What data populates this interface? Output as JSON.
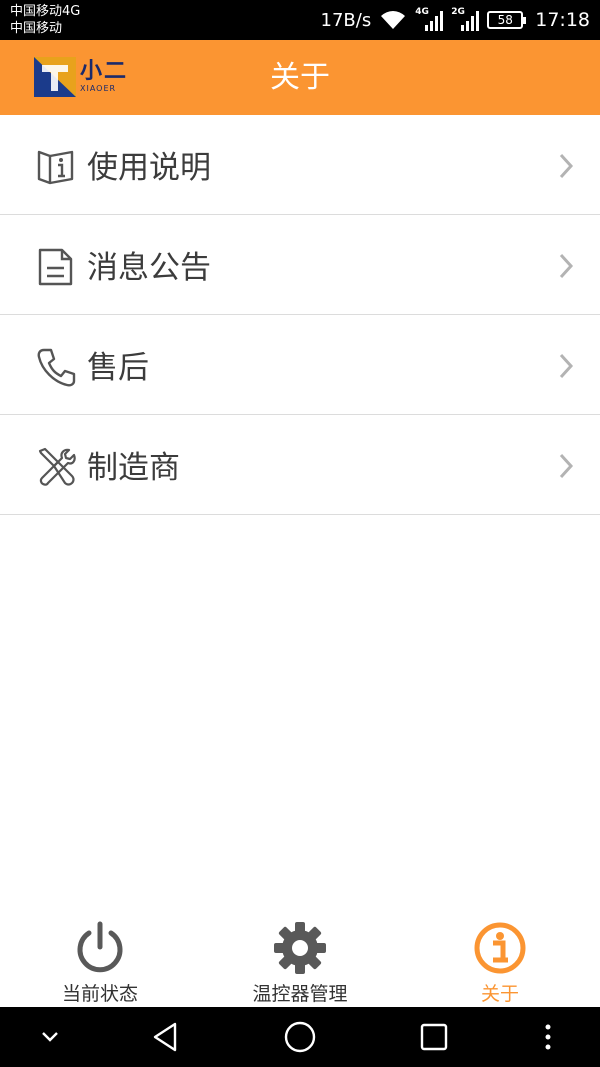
{
  "status_bar": {
    "carrier_1": "中国移动4G",
    "carrier_2": "中国移动",
    "speed": "17B/s",
    "net_4g": "4G",
    "net_2g": "2G",
    "battery": "58",
    "time": "17:18"
  },
  "header": {
    "logo_cn": "小二",
    "logo_en": "XIAOER",
    "title": "关于"
  },
  "menu": {
    "items": [
      {
        "label": "使用说明",
        "icon": "manual-info-icon"
      },
      {
        "label": "消息公告",
        "icon": "document-icon"
      },
      {
        "label": "售后",
        "icon": "phone-icon"
      },
      {
        "label": "制造商",
        "icon": "tools-icon"
      }
    ]
  },
  "bottom_nav": {
    "items": [
      {
        "label": "当前状态",
        "icon": "power-icon",
        "active": false
      },
      {
        "label": "温控器管理",
        "icon": "gear-icon",
        "active": false
      },
      {
        "label": "关于",
        "icon": "info-icon",
        "active": true
      }
    ]
  },
  "colors": {
    "accent": "#fb9532",
    "icon_gray": "#555555",
    "divider": "#dcdcdc"
  }
}
